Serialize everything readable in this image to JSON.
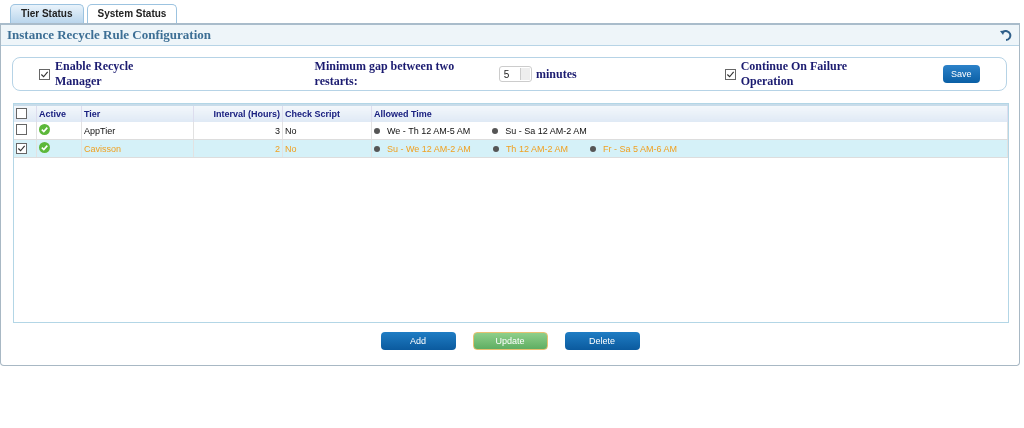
{
  "tabs": [
    {
      "label": "Tier Status",
      "selected": true
    },
    {
      "label": "System Status",
      "selected": false
    }
  ],
  "panel": {
    "title": "Instance Recycle Rule Configuration"
  },
  "settings": {
    "enable_recycle_manager": {
      "label": "Enable Recycle Manager",
      "checked": true
    },
    "min_gap": {
      "label": "Minimum gap between two restarts:",
      "value": "5",
      "unit": "minutes"
    },
    "continue_on_failure": {
      "label": "Continue On Failure Operation",
      "checked": true
    },
    "save": "Save"
  },
  "table": {
    "select_all_checked": false,
    "columns": [
      "Active",
      "Tier",
      "Interval (Hours)",
      "Check Script",
      "Allowed Time"
    ],
    "rows": [
      {
        "selected": false,
        "active": true,
        "tier": "AppTier",
        "interval": "3",
        "check_script": "No",
        "allowed_times": [
          "We - Th 12 AM-5 AM",
          "Su - Sa 12 AM-2 AM"
        ]
      },
      {
        "selected": true,
        "active": true,
        "tier": "Cavisson",
        "interval": "2",
        "check_script": "No",
        "allowed_times": [
          "Su - We 12 AM-2 AM",
          "Th 12 AM-2 AM",
          "Fr - Sa 5 AM-6 AM"
        ]
      }
    ]
  },
  "buttons": [
    {
      "label": "Add",
      "kind": "normal"
    },
    {
      "label": "Update",
      "kind": "highlighted"
    },
    {
      "label": "Delete",
      "kind": "normal"
    }
  ]
}
